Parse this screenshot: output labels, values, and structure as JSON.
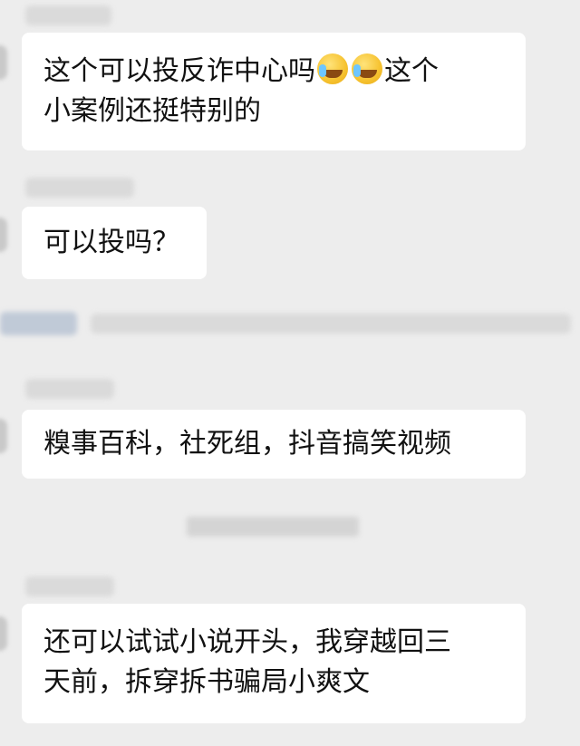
{
  "messages": [
    {
      "line1_before_emoji": "这个可以投反诈中心吗",
      "line1_after_emoji": "这个",
      "line2": "小案例还挺特别的",
      "emoji_icon": "face-with-tears-of-joy"
    },
    {
      "text": "可以投吗？"
    },
    {
      "text": "糗事百科，社死组，抖音搞笑视频"
    },
    {
      "line1": "还可以试试小说开头，我穿越回三",
      "line2": "天前，拆穿拆书骗局小爽文"
    }
  ],
  "colors": {
    "background": "#ededed",
    "bubble": "#ffffff",
    "text": "#111111"
  }
}
